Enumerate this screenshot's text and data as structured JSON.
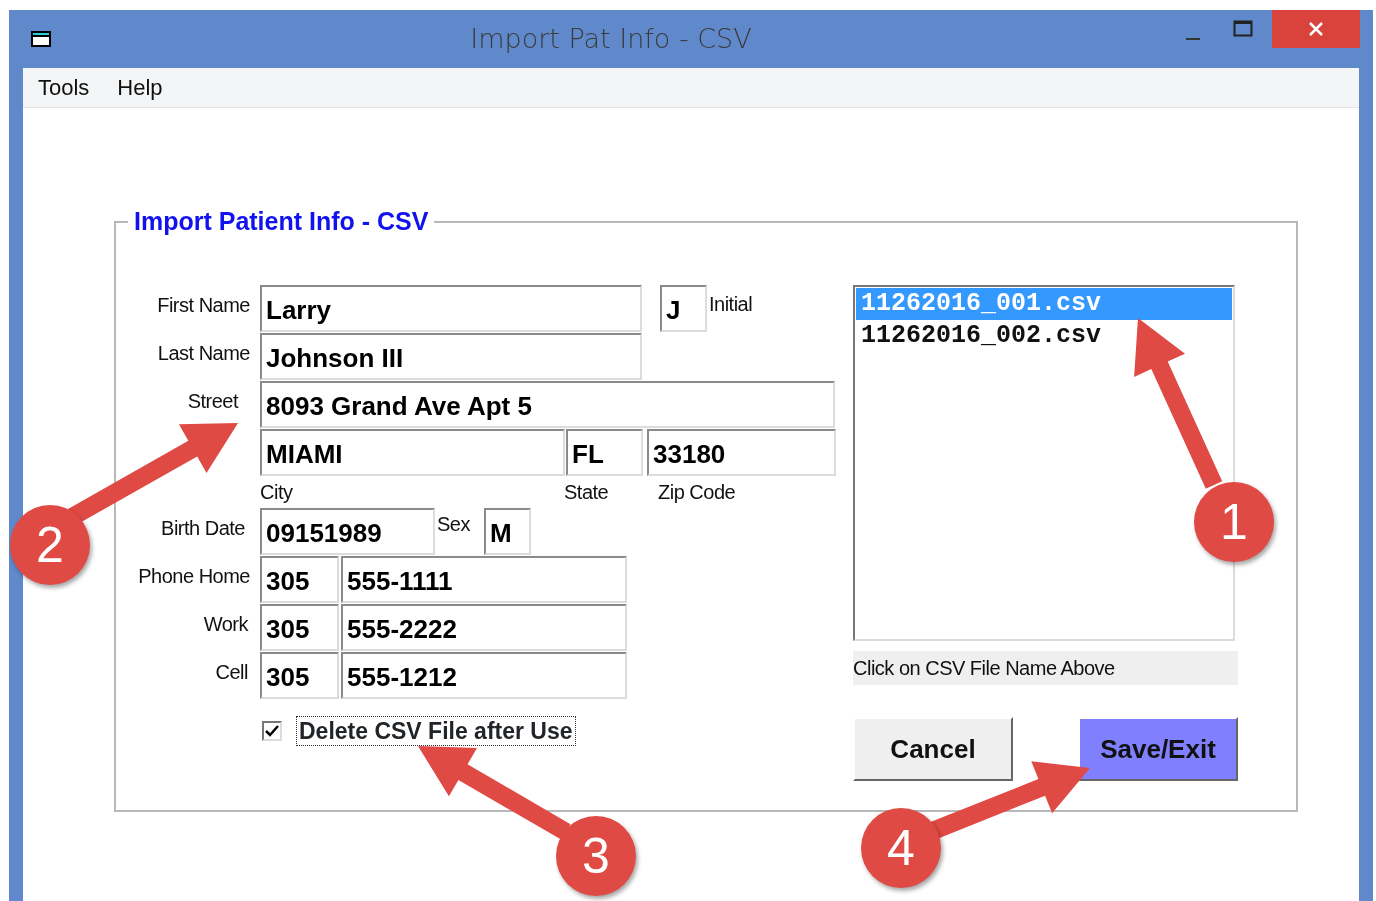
{
  "window": {
    "title": "Import Pat Info - CSV"
  },
  "menu": [
    {
      "label": "Tools"
    },
    {
      "label": "Help"
    }
  ],
  "group": {
    "title": "Import Patient Info - CSV"
  },
  "first_name": {
    "label": "First Name",
    "value": "Larry"
  },
  "initial": {
    "label": "Initial",
    "value": "J"
  },
  "last_name": {
    "label": "Last Name",
    "value": "Johnson III"
  },
  "street": {
    "label": "Street",
    "value": "8093 Grand Ave Apt 5"
  },
  "city": {
    "label": "City",
    "value": "MIAMI"
  },
  "state": {
    "label": "State",
    "value": "FL"
  },
  "zip": {
    "label": "Zip Code",
    "value": "33180"
  },
  "birth_date": {
    "label": "Birth Date",
    "value": "09151989"
  },
  "sex": {
    "label": "Sex",
    "value": "M"
  },
  "phones": [
    {
      "label": "Phone Home",
      "area": "305",
      "number": "555-1111"
    },
    {
      "label": "Work",
      "area": "305",
      "number": "555-2222"
    },
    {
      "label": "Cell",
      "area": "305",
      "number": "555-1212"
    }
  ],
  "delete_after_use": {
    "label": "Delete CSV File after Use",
    "checked": true
  },
  "files": [
    {
      "name": "11262016_001.csv",
      "selected": true
    },
    {
      "name": "11262016_002.csv",
      "selected": false
    }
  ],
  "hint": "Click on CSV File Name Above",
  "buttons": [
    {
      "label": "Cancel",
      "kind": "default"
    },
    {
      "label": "Save/Exit",
      "kind": "primary"
    }
  ],
  "callouts": [
    {
      "label": "1"
    },
    {
      "label": "2"
    },
    {
      "label": "3"
    },
    {
      "label": "4"
    }
  ]
}
